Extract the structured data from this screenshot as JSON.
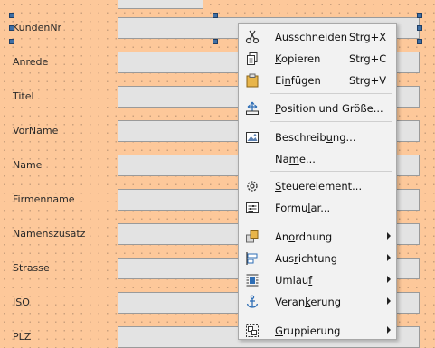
{
  "form": {
    "labels": [
      "KundenNr",
      "Anrede",
      "Titel",
      "VorName",
      "Name",
      "Firmenname",
      "Namenszusatz",
      "Strasse",
      "ISO",
      "PLZ"
    ]
  },
  "context_menu": {
    "items": [
      {
        "pre": "",
        "u": "A",
        "post": "usschneiden",
        "shortcut": "Strg+X",
        "icon": "scissors-icon"
      },
      {
        "pre": "",
        "u": "K",
        "post": "opieren",
        "shortcut": "Strg+C",
        "icon": "copy-icon"
      },
      {
        "pre": "Ei",
        "u": "n",
        "post": "fügen",
        "shortcut": "Strg+V",
        "icon": "paste-icon"
      },
      {
        "pre": "",
        "u": "P",
        "post": "osition und Größe...",
        "shortcut": "",
        "icon": "position-size-icon"
      },
      {
        "pre": "Beschreib",
        "u": "u",
        "post": "ng...",
        "shortcut": "",
        "icon": "description-icon"
      },
      {
        "pre": "Na",
        "u": "m",
        "post": "e...",
        "shortcut": "",
        "icon": ""
      },
      {
        "pre": "",
        "u": "S",
        "post": "teuerelement...",
        "shortcut": "",
        "icon": "control-properties-icon"
      },
      {
        "pre": "Formu",
        "u": "l",
        "post": "ar...",
        "shortcut": "",
        "icon": "form-properties-icon"
      },
      {
        "pre": "An",
        "u": "o",
        "post": "rdnung",
        "shortcut": "",
        "icon": "arrange-icon"
      },
      {
        "pre": "Aus",
        "u": "r",
        "post": "ichtung",
        "shortcut": "",
        "icon": "align-icon"
      },
      {
        "pre": "Umlau",
        "u": "f",
        "post": "",
        "shortcut": "",
        "icon": "wrap-icon"
      },
      {
        "pre": "Veran",
        "u": "k",
        "post": "erung",
        "shortcut": "",
        "icon": "anchor-icon"
      },
      {
        "pre": "",
        "u": "G",
        "post": "ruppierung",
        "shortcut": "",
        "icon": "group-icon"
      }
    ]
  }
}
